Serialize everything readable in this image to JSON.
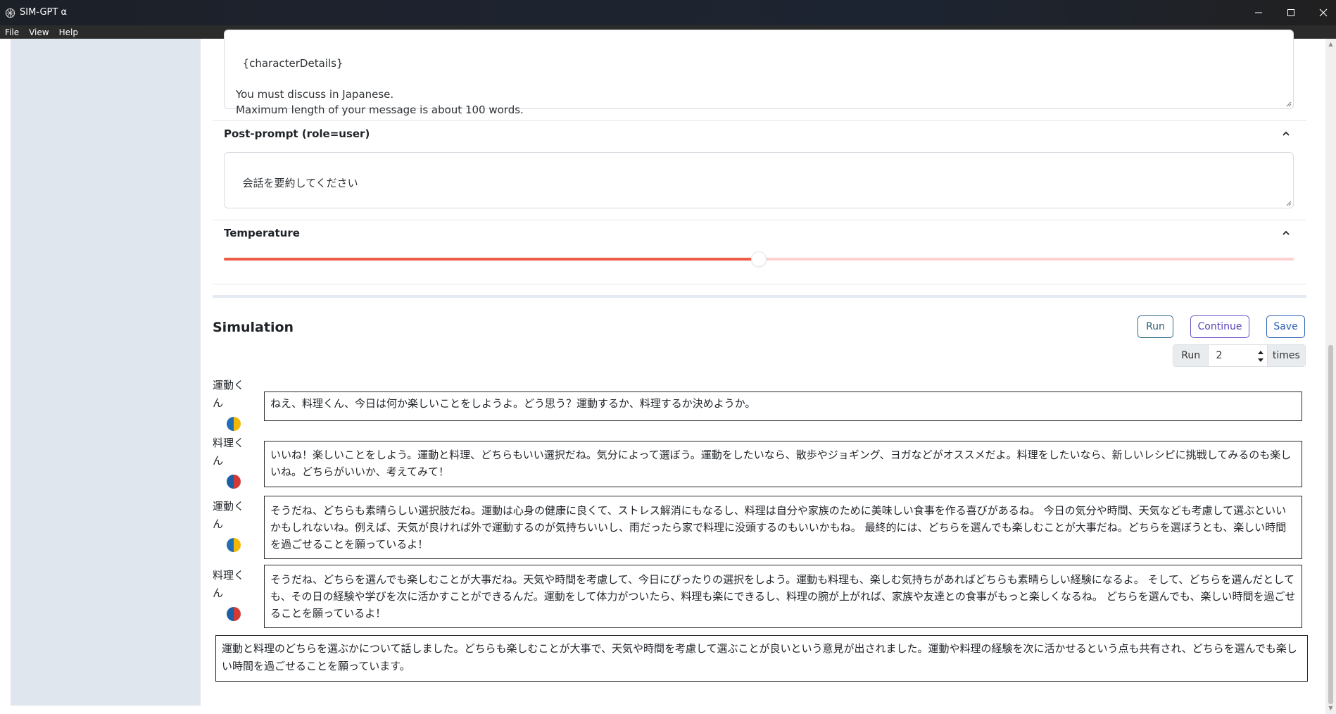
{
  "window": {
    "title": "SIM-GPT α"
  },
  "menu": [
    "File",
    "View",
    "Help"
  ],
  "system_prompt": {
    "text": "{characterDetails}\n\nYou must discuss in Japanese.\nMaximum length of your message is about 100 words."
  },
  "post_prompt": {
    "label": "Post-prompt (role=user)",
    "value": "会話を要約してください"
  },
  "temperature": {
    "label": "Temperature",
    "value_fraction": 0.5
  },
  "simulation": {
    "title": "Simulation",
    "run_label": "Run",
    "continue_label": "Continue",
    "save_label": "Save",
    "run_prefix": "Run",
    "run_count": "2",
    "run_suffix": "times"
  },
  "messages": [
    {
      "speaker": "運動くん",
      "avatar_colors": [
        "#f2b705",
        "#1f6fb2"
      ],
      "text": "ねえ、料理くん、今日は何か楽しいことをしようよ。どう思う？運動するか、料理するか決めようか。"
    },
    {
      "speaker": "料理くん",
      "avatar_colors": [
        "#d33a36",
        "#1b5fa6"
      ],
      "text": "いいね！楽しいことをしよう。運動と料理、どちらもいい選択だね。気分によって選ぼう。運動をしたいなら、散歩やジョギング、ヨガなどがオススメだよ。料理をしたいなら、新しいレシピに挑戦してみるのも楽しいね。どちらがいいか、考えてみて！"
    },
    {
      "speaker": "運動くん",
      "avatar_colors": [
        "#f2b705",
        "#1f6fb2"
      ],
      "text": "そうだね、どちらも素晴らしい選択肢だね。運動は心身の健康に良くて、ストレス解消にもなるし、料理は自分や家族のために美味しい食事を作る喜びがあるね。 今日の気分や時間、天気なども考慮して選ぶといいかもしれないね。例えば、天気が良ければ外で運動するのが気持ちいいし、雨だったら家で料理に没頭するのもいいかもね。 最終的には、どちらを選んでも楽しむことが大事だね。どちらを選ぼうとも、楽しい時間を過ごせることを願っているよ！"
    },
    {
      "speaker": "料理くん",
      "avatar_colors": [
        "#d33a36",
        "#1b5fa6"
      ],
      "text": "そうだね、どちらを選んでも楽しむことが大事だね。天気や時間を考慮して、今日にぴったりの選択をしよう。運動も料理も、楽しむ気持ちがあればどちらも素晴らしい経験になるよ。 そして、どちらを選んだとしても、その日の経験や学びを次に活かすことができるんだ。運動をして体力がついたら、料理も楽にできるし、料理の腕が上がれば、家族や友達との食事がもっと楽しくなるね。 どちらを選んでも、楽しい時間を過ごせることを願っているよ！"
    }
  ],
  "summary": "運動と料理のどちらを選ぶかについて話しました。どちらも楽しむことが大事で、天気や時間を考慮して選ぶことが良いという意見が出されました。運動や料理の経験を次に活かせるという点も共有され、どちらを選んでも楽しい時間を過ごせることを願っています。"
}
